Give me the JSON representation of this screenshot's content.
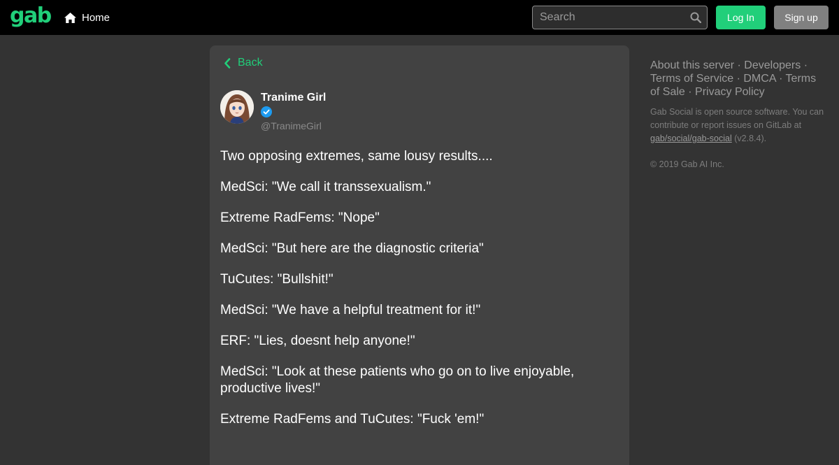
{
  "header": {
    "logo": "gab",
    "home_label": "Home",
    "search_placeholder": "Search",
    "login_label": "Log In",
    "signup_label": "Sign up"
  },
  "colors": {
    "accent": "#21cf7a",
    "background": "#333333",
    "card": "#424242",
    "topbar": "#000000",
    "verified": "#1d9bf0"
  },
  "post": {
    "back_label": "Back",
    "display_name": "Tranime Girl",
    "handle": "@TranimeGirl",
    "paragraphs": [
      "Two opposing extremes, same lousy results....",
      "MedSci: \"We call it transsexualism.\"",
      "Extreme RadFems: \"Nope\"",
      "MedSci: \"But here are the diagnostic criteria\"",
      "TuCutes: \"Bullshit!\"",
      "MedSci: \"We have a helpful treatment for it!\"",
      "ERF: \"Lies, doesnt help anyone!\"",
      "MedSci: \"Look at these patients who go on to live enjoyable, productive lives!\"",
      "Extreme RadFems and TuCutes: \"Fuck 'em!\""
    ]
  },
  "sidebar": {
    "links": [
      "About this server",
      "Developers",
      "Terms of Service",
      "DMCA",
      "Terms of Sale",
      "Privacy Policy"
    ],
    "separator": "·",
    "about_text": "Gab Social is open source software. You can contribute or report issues on GitLab at",
    "repo_link": "gab/social/gab-social",
    "version": "(v2.8.4).",
    "copyright": "© 2019 Gab AI Inc."
  },
  "icons": [
    "home-icon",
    "search-icon",
    "chevron-left-icon",
    "verified-badge-icon"
  ]
}
